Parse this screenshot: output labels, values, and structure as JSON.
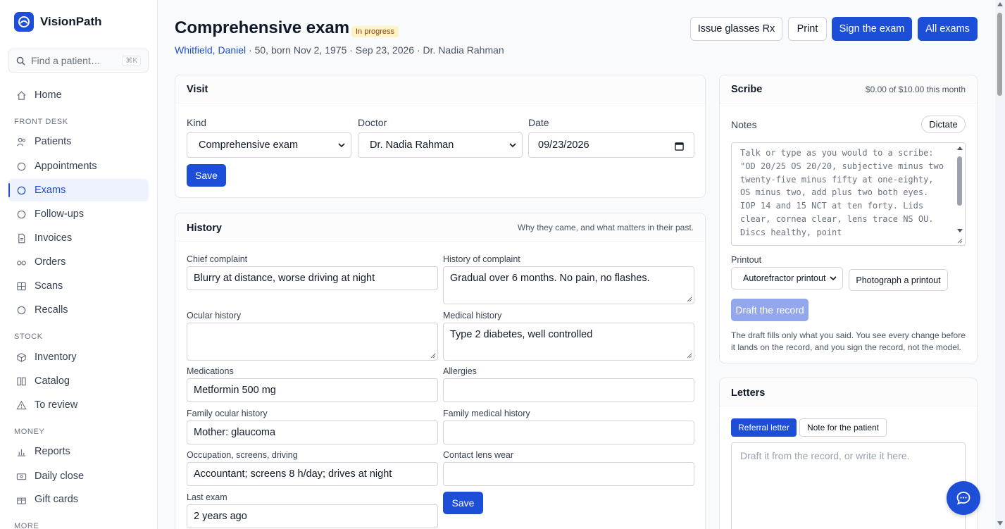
{
  "app": {
    "name": "VisionPath"
  },
  "search": {
    "placeholder": "Find a patient…",
    "shortcut": "⌘K"
  },
  "nav": {
    "home": "Home",
    "sections": {
      "front_desk": "FRONT DESK",
      "stock": "STOCK",
      "money": "MONEY",
      "more": "MORE"
    },
    "items": {
      "patients": "Patients",
      "appointments": "Appointments",
      "exams": "Exams",
      "followups": "Follow-ups",
      "invoices": "Invoices",
      "orders": "Orders",
      "scans": "Scans",
      "recalls": "Recalls",
      "inventory": "Inventory",
      "catalog": "Catalog",
      "to_review": "To review",
      "reports": "Reports",
      "daily_close": "Daily close",
      "gift_cards": "Gift cards"
    },
    "active": "exams"
  },
  "header": {
    "title": "Comprehensive exam",
    "status": "In progress",
    "patient_name": "Whitfield, Daniel",
    "patient_info": " · 50, born Nov 2, 1975 · Sep 23, 2026 · Dr. Nadia Rahman",
    "buttons": {
      "issue_rx": "Issue glasses Rx",
      "print": "Print",
      "sign": "Sign the exam",
      "all_exams": "All exams"
    }
  },
  "visit": {
    "title": "Visit",
    "kind_label": "Kind",
    "kind_value": "Comprehensive exam",
    "doctor_label": "Doctor",
    "doctor_value": "Dr. Nadia Rahman",
    "date_label": "Date",
    "date_value": "09/23/2026",
    "save": "Save"
  },
  "history": {
    "title": "History",
    "meta": "Why they came, and what matters in their past.",
    "chief_complaint": {
      "label": "Chief complaint",
      "value": "Blurry at distance, worse driving at night"
    },
    "history_of_complaint": {
      "label": "History of complaint",
      "value": "Gradual over 6 months. No pain, no flashes."
    },
    "ocular_history": {
      "label": "Ocular history",
      "value": ""
    },
    "medical_history": {
      "label": "Medical history",
      "value": "Type 2 diabetes, well controlled"
    },
    "medications": {
      "label": "Medications",
      "value": "Metformin 500 mg"
    },
    "allergies": {
      "label": "Allergies",
      "value": ""
    },
    "family_ocular": {
      "label": "Family ocular history",
      "value": "Mother: glaucoma"
    },
    "family_medical": {
      "label": "Family medical history",
      "value": ""
    },
    "occupation": {
      "label": "Occupation, screens, driving",
      "value": "Accountant; screens 8 h/day; drives at night"
    },
    "contact_lens": {
      "label": "Contact lens wear",
      "value": ""
    },
    "last_exam": {
      "label": "Last exam",
      "value": "2 years ago"
    },
    "save": "Save"
  },
  "scribe": {
    "title": "Scribe",
    "usage": "$0.00 of $10.00 this month",
    "notes_label": "Notes",
    "dictate": "Dictate",
    "notes_placeholder": "Talk or type as you would to a scribe:\n\"OD 20/25 OS 20/20, subjective minus two twenty-five minus fifty at one-eighty, OS minus two, add plus two both eyes. IOP 14 and 15 NCT at ten forty. Lids clear, cornea clear, lens trace NS OU. Discs healthy, point",
    "printout_label": "Printout",
    "printout_value": "Autorefractor printout",
    "photograph": "Photograph a printout",
    "draft": "Draft the record",
    "disclaimer": "The draft fills only what you said. You see every change before it lands on the record, and you sign the record, not the model."
  },
  "letters": {
    "title": "Letters",
    "tabs": {
      "referral": "Referral letter",
      "patient_note": "Note for the patient"
    },
    "placeholder": "Draft it from the record, or write it here."
  },
  "colors": {
    "accent": "#1d4ed8",
    "badge_bg": "#fef3c7",
    "badge_text": "#92400e"
  }
}
